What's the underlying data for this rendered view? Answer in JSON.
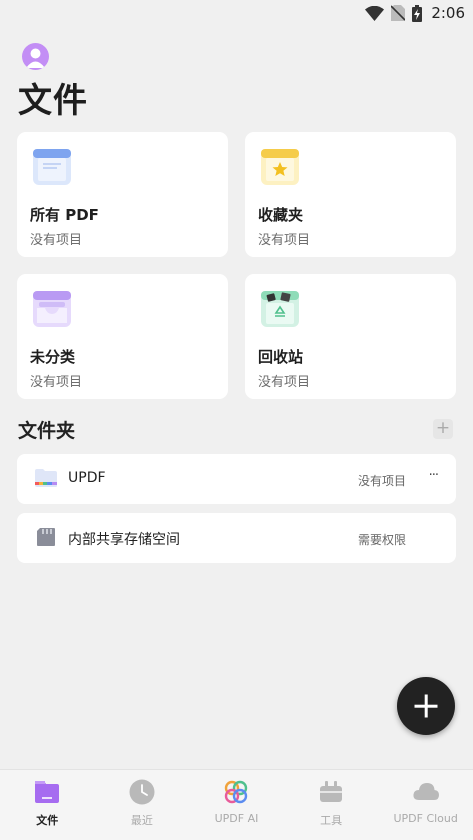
{
  "status_bar": {
    "time": "2:06"
  },
  "header": {
    "title": "文件"
  },
  "cards": [
    {
      "title": "所有 PDF",
      "subtitle": "没有项目",
      "icon": "all-pdf-icon"
    },
    {
      "title": "收藏夹",
      "subtitle": "没有项目",
      "icon": "favorites-star-icon"
    },
    {
      "title": "未分类",
      "subtitle": "没有项目",
      "icon": "uncategorized-tray-icon"
    },
    {
      "title": "回收站",
      "subtitle": "没有项目",
      "icon": "recycle-bin-icon"
    }
  ],
  "folders_section": {
    "title": "文件夹",
    "add_label": "+",
    "rows": [
      {
        "name": "UPDF",
        "status": "没有项目",
        "more": "···",
        "icon": "folder-icon"
      },
      {
        "name": "内部共享存储空间",
        "status": "需要权限",
        "icon": "sd-card-icon"
      }
    ]
  },
  "bottom_nav": {
    "items": [
      {
        "label": "文件",
        "icon": "files-icon",
        "active": true
      },
      {
        "label": "最近",
        "icon": "clock-icon",
        "active": false
      },
      {
        "label": "UPDF AI",
        "icon": "ai-icon",
        "active": false
      },
      {
        "label": "工具",
        "icon": "toolbox-icon",
        "active": false
      },
      {
        "label": "UPDF Cloud",
        "icon": "cloud-icon",
        "active": false
      }
    ]
  }
}
